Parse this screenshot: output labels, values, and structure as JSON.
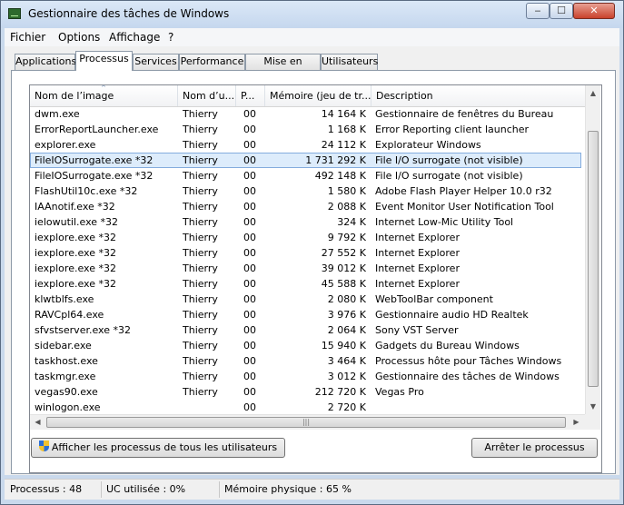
{
  "window": {
    "title": "Gestionnaire des tâches de Windows"
  },
  "titlebar_buttons": {
    "minimize": "‒",
    "maximize": "☐",
    "close": "✕"
  },
  "menu": [
    "Fichier",
    "Options",
    "Affichage",
    "?"
  ],
  "tabs": [
    "Applications",
    "Processus",
    "Services",
    "Performance",
    "Mise en réseau",
    "Utilisateurs"
  ],
  "active_tab": "Processus",
  "columns": [
    "Nom de l’image",
    "Nom d’u...",
    "P...",
    "Mémoire (jeu de tr...",
    "Description"
  ],
  "sort_indicator": "^",
  "processes": [
    {
      "name": "dwm.exe",
      "user": "Thierry",
      "prio": "00",
      "mem": "14 164 K",
      "desc": "Gestionnaire de fenêtres du Bureau"
    },
    {
      "name": "ErrorReportLauncher.exe",
      "user": "Thierry",
      "prio": "00",
      "mem": "1 168 K",
      "desc": "Error Reporting client launcher"
    },
    {
      "name": "explorer.exe",
      "user": "Thierry",
      "prio": "00",
      "mem": "24 112 K",
      "desc": "Explorateur Windows"
    },
    {
      "name": "FileIOSurrogate.exe *32",
      "user": "Thierry",
      "prio": "00",
      "mem": "1 731 292 K",
      "desc": "File I/O surrogate (not visible)",
      "selected": true
    },
    {
      "name": "FileIOSurrogate.exe *32",
      "user": "Thierry",
      "prio": "00",
      "mem": "492 148 K",
      "desc": "File I/O surrogate (not visible)"
    },
    {
      "name": "FlashUtil10c.exe *32",
      "user": "Thierry",
      "prio": "00",
      "mem": "1 580 K",
      "desc": "Adobe Flash Player Helper 10.0 r32"
    },
    {
      "name": "IAAnotif.exe *32",
      "user": "Thierry",
      "prio": "00",
      "mem": "2 088 K",
      "desc": "Event Monitor User Notification Tool"
    },
    {
      "name": "ielowutil.exe *32",
      "user": "Thierry",
      "prio": "00",
      "mem": "324 K",
      "desc": "Internet Low-Mic Utility Tool"
    },
    {
      "name": "iexplore.exe *32",
      "user": "Thierry",
      "prio": "00",
      "mem": "9 792 K",
      "desc": "Internet Explorer"
    },
    {
      "name": "iexplore.exe *32",
      "user": "Thierry",
      "prio": "00",
      "mem": "27 552 K",
      "desc": "Internet Explorer"
    },
    {
      "name": "iexplore.exe *32",
      "user": "Thierry",
      "prio": "00",
      "mem": "39 012 K",
      "desc": "Internet Explorer"
    },
    {
      "name": "iexplore.exe *32",
      "user": "Thierry",
      "prio": "00",
      "mem": "45 588 K",
      "desc": "Internet Explorer"
    },
    {
      "name": "klwtblfs.exe",
      "user": "Thierry",
      "prio": "00",
      "mem": "2 080 K",
      "desc": "WebToolBar component"
    },
    {
      "name": "RAVCpl64.exe",
      "user": "Thierry",
      "prio": "00",
      "mem": "3 976 K",
      "desc": "Gestionnaire audio HD Realtek"
    },
    {
      "name": "sfvstserver.exe *32",
      "user": "Thierry",
      "prio": "00",
      "mem": "2 064 K",
      "desc": "Sony VST Server"
    },
    {
      "name": "sidebar.exe",
      "user": "Thierry",
      "prio": "00",
      "mem": "15 940 K",
      "desc": "Gadgets du Bureau Windows"
    },
    {
      "name": "taskhost.exe",
      "user": "Thierry",
      "prio": "00",
      "mem": "3 464 K",
      "desc": "Processus hôte pour Tâches Windows"
    },
    {
      "name": "taskmgr.exe",
      "user": "Thierry",
      "prio": "00",
      "mem": "3 012 K",
      "desc": "Gestionnaire des tâches de Windows"
    },
    {
      "name": "vegas90.exe",
      "user": "Thierry",
      "prio": "00",
      "mem": "212 720 K",
      "desc": "Vegas Pro"
    },
    {
      "name": "winlogon.exe",
      "user": "",
      "prio": "00",
      "mem": "2 720 K",
      "desc": ""
    }
  ],
  "scroll_glyphs": {
    "up": "▲",
    "down": "▼",
    "left": "◀",
    "right": "▶",
    "grip": "|||"
  },
  "buttons": {
    "show_all": "Afficher les processus de tous les utilisateurs",
    "end_process": "Arrêter le processus"
  },
  "status": {
    "processes": "Processus : 48",
    "cpu": "UC utilisée : 0%",
    "memory": "Mémoire physique : 65 %"
  }
}
